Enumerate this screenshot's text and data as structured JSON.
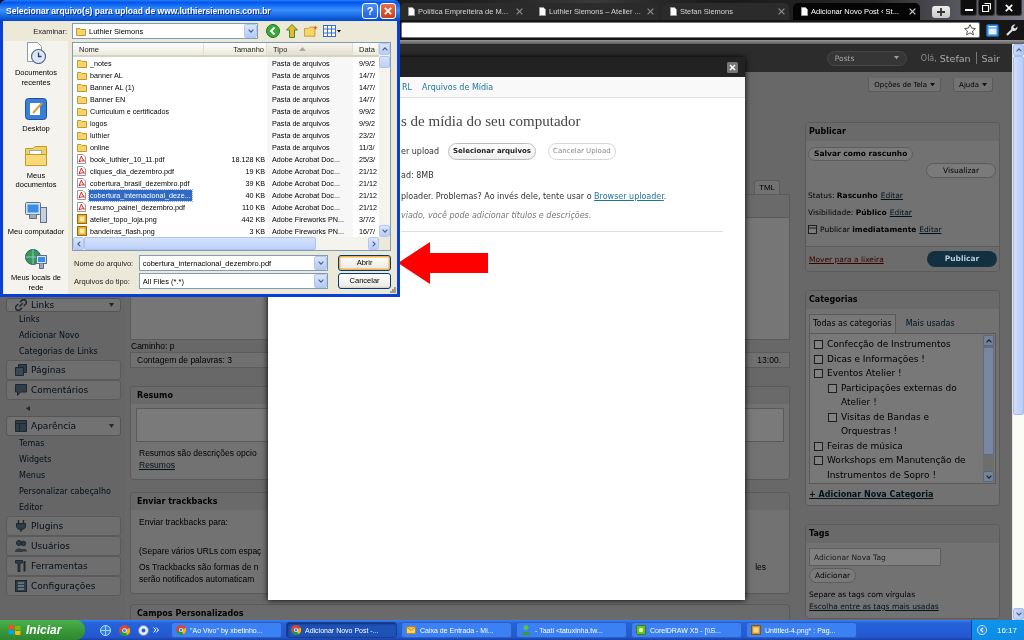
{
  "browser": {
    "tabs": [
      {
        "title": "Política Empreiteira de M...",
        "selected": false
      },
      {
        "title": "Luthier Siemons – Atelier ...",
        "selected": false
      },
      {
        "title": "Stefan Siemons",
        "selected": false
      },
      {
        "title": "Adicionar Novo Post ‹ St...",
        "selected": true
      }
    ]
  },
  "file_dialog": {
    "title": "Selecionar arquivo(s) para upload de www.luthiersiemons.com.br",
    "help": "?",
    "look_in_label": "Examinar:",
    "look_in": "Luthier Siemons",
    "places": [
      "Documentos recentes",
      "Desktop",
      "Meus documentos",
      "Meu computador",
      "Meus locais de rede"
    ],
    "columns": [
      {
        "label": "Nome",
        "sorted": false
      },
      {
        "label": "Tamanho",
        "sorted": false
      },
      {
        "label": "Tipo",
        "sorted": true
      },
      {
        "label": "Data",
        "sorted": false
      }
    ],
    "files": [
      {
        "kind": "folder",
        "name": "_notes",
        "type": "Pasta de arquivos",
        "date": "9/9/2",
        "selected": false
      },
      {
        "kind": "folder",
        "name": "banner AL",
        "type": "Pasta de arquivos",
        "date": "14/7/",
        "selected": false
      },
      {
        "kind": "folder",
        "name": "Banner AL (1)",
        "type": "Pasta de arquivos",
        "date": "14/7/",
        "selected": false
      },
      {
        "kind": "folder",
        "name": "Banner EN",
        "type": "Pasta de arquivos",
        "date": "14/7/",
        "selected": false
      },
      {
        "kind": "folder",
        "name": "Curriculum e certificados",
        "type": "Pasta de arquivos",
        "date": "9/9/2",
        "selected": false
      },
      {
        "kind": "folder",
        "name": "logos",
        "type": "Pasta de arquivos",
        "date": "9/9/2",
        "selected": false
      },
      {
        "kind": "folder",
        "name": "luthier",
        "type": "Pasta de arquivos",
        "date": "23/2/",
        "selected": false
      },
      {
        "kind": "folder",
        "name": "online",
        "type": "Pasta de arquivos",
        "date": "11/3/",
        "selected": false
      },
      {
        "kind": "pdf",
        "name": "book_luthier_10_11.pdf",
        "size": "18.128 KB",
        "type": "Adobe Acrobat Doc...",
        "date": "25/3/",
        "selected": false
      },
      {
        "kind": "pdf",
        "name": "cliques_dia_dezembro.pdf",
        "size": "19 KB",
        "type": "Adobe Acrobat Doc...",
        "date": "21/12",
        "selected": false
      },
      {
        "kind": "pdf",
        "name": "cobertura_brasil_dezembro.pdf",
        "size": "39 KB",
        "type": "Adobe Acrobat Doc...",
        "date": "21/12",
        "selected": false
      },
      {
        "kind": "pdf",
        "name": "cobertura_internacional_deze...",
        "size": "40 KB",
        "type": "Adobe Acrobat Doc...",
        "date": "21/12",
        "selected": true
      },
      {
        "kind": "pdf",
        "name": "resumo_painel_dezembro.pdf",
        "size": "110 KB",
        "type": "Adobe Acrobat Doc...",
        "date": "21/12",
        "selected": false
      },
      {
        "kind": "png",
        "name": "atelier_topo_loja.png",
        "size": "442 KB",
        "type": "Adobe Fireworks PN...",
        "date": "3/7/2",
        "selected": false
      },
      {
        "kind": "png",
        "name": "bandeiras_flash.png",
        "size": "3 KB",
        "type": "Adobe Fireworks PN...",
        "date": "16/7/",
        "selected": false
      }
    ],
    "fields": [
      {
        "label": "Nome do arquivo:",
        "value": "cobertura_internacional_dezembro.pdf",
        "button": {
          "label": "Abrir",
          "focused": true
        }
      },
      {
        "label": "Arquivos do tipo:",
        "value": "All Files (*.*)",
        "button": {
          "label": "Cancelar",
          "focused": false
        }
      }
    ]
  },
  "wp_header": {
    "favorites": "Posts",
    "greeting": "Olá,",
    "user": "Stefan",
    "logout": "Sair"
  },
  "screen_meta": [
    "Opções de Tela",
    "Ajuda"
  ],
  "upload_modal": {
    "tabs": [
      {
        "label": "RL",
        "selected": false
      },
      {
        "label": "Arquivos de Mídia",
        "selected": false
      }
    ],
    "heading": "s de mídia do seu computador",
    "select_label": "er upload",
    "buttons": [
      {
        "label": "Selecionar arquivos",
        "disabled": false
      },
      {
        "label": "Cancelar Upload",
        "disabled": true
      }
    ],
    "max_size": "ad: 8MB",
    "problem": {
      "text": "ploader. Problemas? Ao invés dele, tente usar o ",
      "link": "Browser uploader",
      "after": "."
    },
    "note": "viado, você pode adicionar títulos e descrições."
  },
  "admin_menu": [
    {
      "kind": "menu",
      "label": "Links",
      "expanded": true,
      "children": [
        {
          "label": "Links"
        },
        {
          "label": "Adicionar Novo"
        },
        {
          "label": "Categorias de Links"
        }
      ]
    },
    {
      "kind": "menu",
      "label": "Páginas",
      "expanded": false
    },
    {
      "kind": "menu",
      "label": "Comentários",
      "expanded": false
    },
    {
      "kind": "separator"
    },
    {
      "kind": "menu",
      "label": "Aparência",
      "expanded": true,
      "children": [
        {
          "label": "Temas"
        },
        {
          "label": "Widgets"
        },
        {
          "label": "Menus"
        },
        {
          "label": "Personalizar cabeçalho"
        },
        {
          "label": "Editor"
        }
      ]
    },
    {
      "kind": "menu",
      "label": "Plugins",
      "expanded": false
    },
    {
      "kind": "menu",
      "label": "Usuários",
      "expanded": false
    },
    {
      "kind": "menu",
      "label": "Ferramentas",
      "expanded": false
    },
    {
      "kind": "menu",
      "label": "Configurações",
      "expanded": false
    }
  ],
  "editor": {
    "tab": "TML",
    "path": "Caminho: p",
    "word_count": "Contagem de palavras: 3",
    "last_edit": "13:00."
  },
  "excerpt": {
    "title": "Resumo",
    "hint": "Resumos são descrições opcio",
    "link": "Resumos"
  },
  "trackbacks": {
    "title": "Enviar trackbacks",
    "label": "Enviar trackbacks para:",
    "note": "(Separe vários URLs com espaç",
    "info": {
      "lines": [
        "Os Trackbacks são formas de n",
        "serão notificados automaticam"
      ],
      "tail": "les"
    }
  },
  "custom_fields": {
    "title": "Campos Personalizados"
  },
  "publish_box": {
    "title": "Publicar",
    "save_draft": "Salvar como rascunho",
    "preview": "Visualizar",
    "rows": [
      {
        "kind": "status",
        "text": "Status: **Rascunho**",
        "link": "Editar"
      },
      {
        "kind": "visibility",
        "text": "Visibilidade: **Público**",
        "link": "Editar"
      },
      {
        "kind": "schedule",
        "text": "Publicar **imediatamente**",
        "link": "Editar"
      }
    ],
    "trash": "Mover para a lixeira",
    "publish": "Publicar"
  },
  "categories_box": {
    "title": "Categorias",
    "tabs": [
      {
        "label": "Todas as categorias",
        "selected": true
      },
      {
        "label": "Mais usadas",
        "selected": false
      }
    ],
    "items": [
      {
        "label": "Confecção de Instrumentos",
        "checked": false
      },
      {
        "label": "Dicas e Informações !",
        "checked": false
      },
      {
        "label": "Eventos Atelier !",
        "checked": false,
        "children": [
          {
            "label": "Participações externas do Atelier !",
            "checked": false
          },
          {
            "label": "Visitas de Bandas e Orquestras !",
            "checked": false
          }
        ]
      },
      {
        "label": "Feiras de música",
        "checked": false
      },
      {
        "label": "Workshops em Manutenção de Instrumentos de Sopro !",
        "checked": false
      }
    ],
    "add_link": "+ Adicionar Nova Categoria"
  },
  "tags_box": {
    "title": "Tags",
    "placeholder": "Adicionar Nova Tag",
    "add_button": "Adicionar",
    "hint": "Separe as tags com vírgulas",
    "link": "Escolha entre as tags mais usadas"
  },
  "taskbar": {
    "start": "Iniciar",
    "tasks": [
      {
        "label": "\"Ao Vivo\" by xbetinho...",
        "selected": false
      },
      {
        "label": "Adicionar Novo Post -...",
        "selected": true
      },
      {
        "label": "Caixa de Entrada - Mi...",
        "selected": false
      },
      {
        "label": "- Taati <tatuxinha.tw...",
        "selected": false
      },
      {
        "label": "CorelDRAW X5 - [\\\\S...",
        "selected": false
      },
      {
        "label": "Untitled-4.png* : Pag...",
        "selected": false
      }
    ],
    "clock": "16:17"
  }
}
